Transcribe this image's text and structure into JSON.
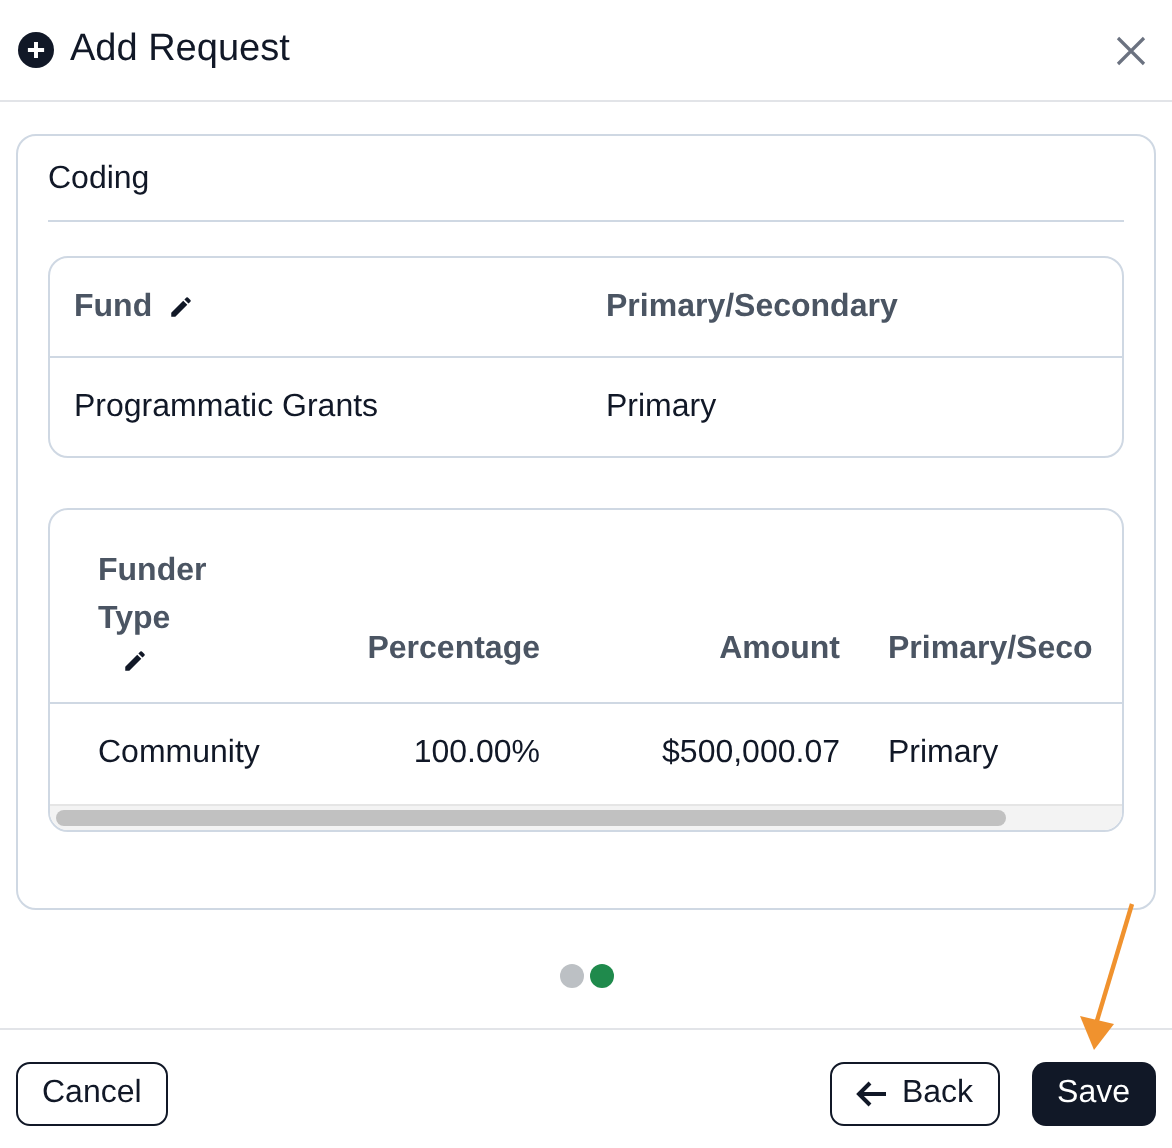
{
  "dialog": {
    "title": "Add Request"
  },
  "section": {
    "title": "Coding",
    "fund_table": {
      "columns": [
        {
          "label": "Fund",
          "editable": true
        },
        {
          "label": "Primary/Secondary",
          "editable": false
        }
      ],
      "rows": [
        [
          "Programmatic Grants",
          "Primary"
        ]
      ]
    },
    "funder_table": {
      "columns": [
        {
          "label": "Funder Type",
          "editable": true,
          "kind": "text"
        },
        {
          "label": "Percentage",
          "editable": false,
          "kind": "number"
        },
        {
          "label": "Amount",
          "editable": false,
          "kind": "number"
        },
        {
          "label": "Primary/Seco",
          "editable": false,
          "kind": "text"
        }
      ],
      "rows": [
        [
          "Community",
          "100.00%",
          "$500,000.07",
          "Primary"
        ]
      ]
    }
  },
  "pager": [
    {
      "selected": false
    },
    {
      "selected": true
    }
  ],
  "buttons": {
    "cancel": "Cancel",
    "back": "Back",
    "save": "Save"
  }
}
